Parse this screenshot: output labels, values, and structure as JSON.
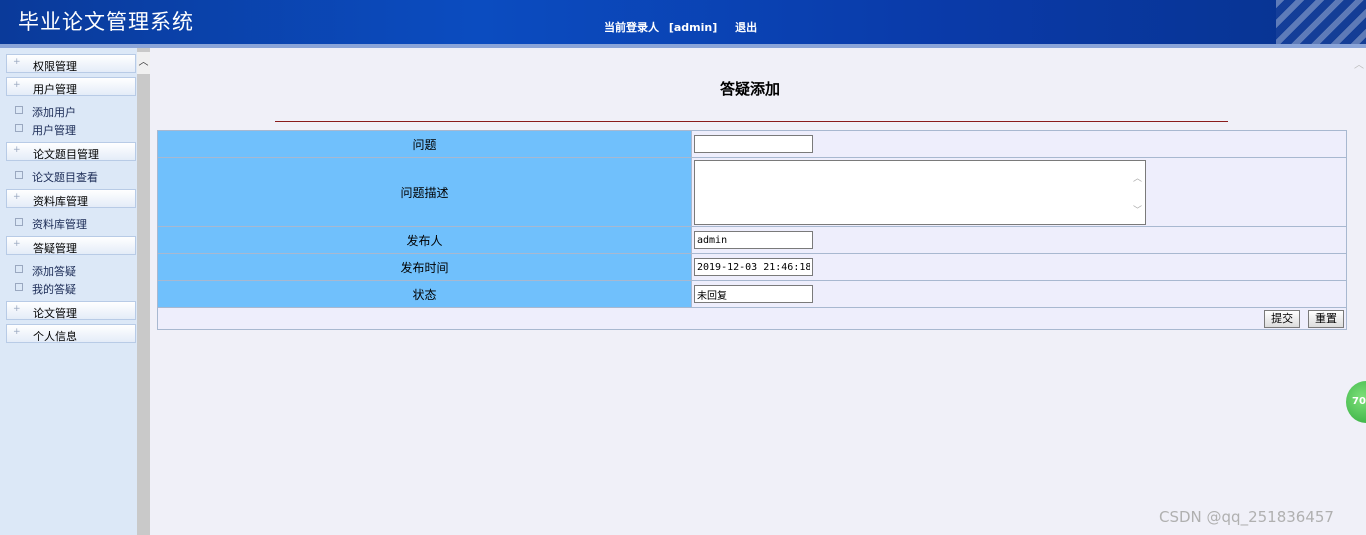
{
  "header": {
    "title": "毕业论文管理系统",
    "user_label": "当前登录人",
    "user_name": "[admin]",
    "logout": "退出"
  },
  "sidebar": {
    "groups": [
      {
        "label": "权限管理",
        "items": []
      },
      {
        "label": "用户管理",
        "items": [
          "添加用户",
          "用户管理"
        ]
      },
      {
        "label": "论文题目管理",
        "items": [
          "论文题目查看"
        ]
      },
      {
        "label": "资料库管理",
        "items": [
          "资料库管理"
        ]
      },
      {
        "label": "答疑管理",
        "items": [
          "添加答疑",
          "我的答疑"
        ]
      },
      {
        "label": "论文管理",
        "items": []
      },
      {
        "label": "个人信息",
        "items": []
      }
    ]
  },
  "main": {
    "title": "答疑添加",
    "fields": {
      "question": {
        "label": "问题",
        "value": ""
      },
      "description": {
        "label": "问题描述",
        "value": ""
      },
      "publisher": {
        "label": "发布人",
        "value": "admin"
      },
      "publish_time": {
        "label": "发布时间",
        "value": "2019-12-03 21:46:18"
      },
      "status": {
        "label": "状态",
        "value": "未回复"
      }
    },
    "buttons": {
      "submit": "提交",
      "reset": "重置"
    }
  },
  "badge": {
    "text": "70"
  },
  "watermark": "CSDN @qq_251836457"
}
